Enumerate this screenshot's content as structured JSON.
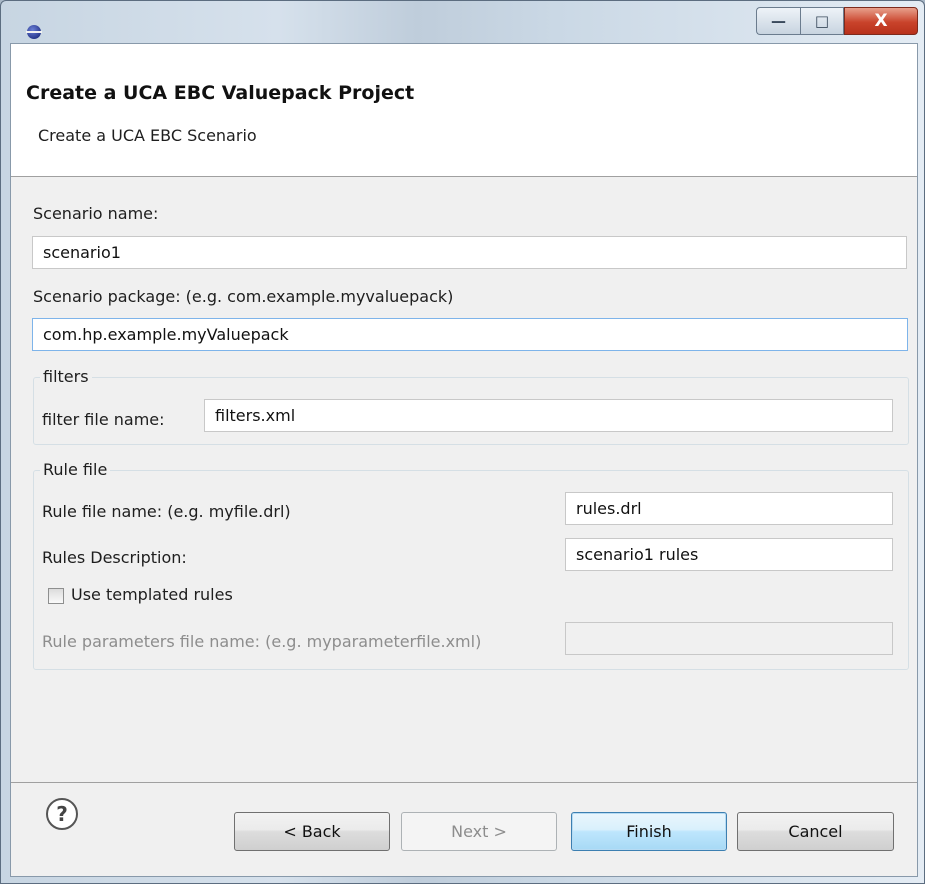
{
  "window": {
    "icon": "eclipse-app-icon",
    "controls": {
      "minimize": "—",
      "maximize": "□",
      "close": "X"
    }
  },
  "banner": {
    "title": "Create a UCA EBC Valuepack Project",
    "subtitle": "Create a UCA EBC Scenario"
  },
  "form": {
    "scenario_name_label": "Scenario name:",
    "scenario_name_value": "scenario1",
    "scenario_package_label": "Scenario package: (e.g. com.example.myvaluepack)",
    "scenario_package_value": "com.hp.example.myValuepack",
    "filters": {
      "legend": "filters",
      "file_name_label": "filter file name:",
      "file_name_value": "filters.xml"
    },
    "rule_file": {
      "legend": "Rule file",
      "name_label": "Rule file name: (e.g. myfile.drl)",
      "name_value": "rules.drl",
      "description_label": "Rules Description:",
      "description_value": "scenario1 rules",
      "templated_label": "Use templated rules",
      "templated_checked": false,
      "params_label": "Rule parameters file name: (e.g. myparameterfile.xml)",
      "params_value": ""
    }
  },
  "footer": {
    "help_icon": "help-icon",
    "help_glyph": "?",
    "back_label": "< Back",
    "next_label": "Next >",
    "finish_label": "Finish",
    "cancel_label": "Cancel"
  }
}
